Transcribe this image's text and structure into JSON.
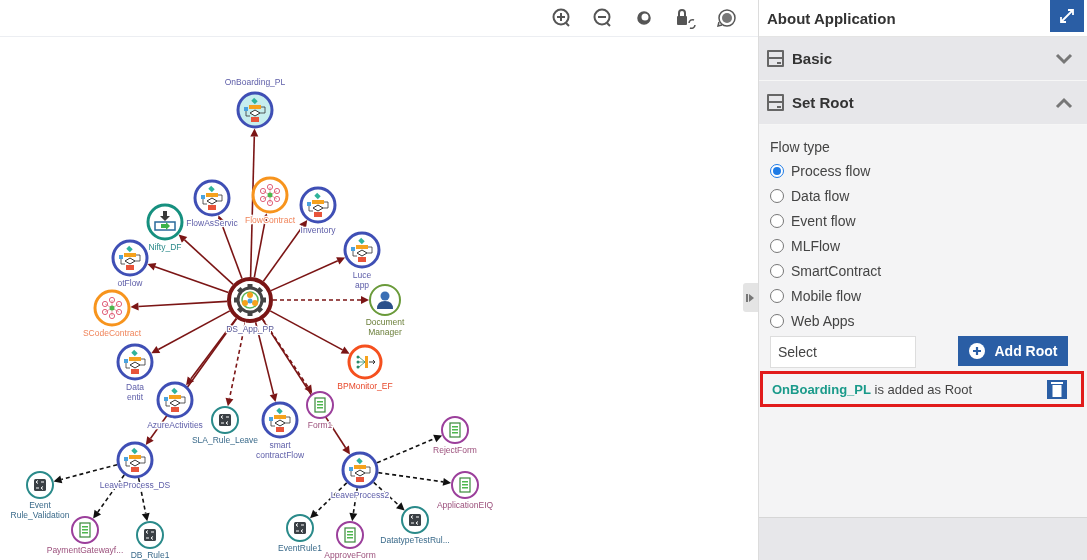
{
  "toolbar": {
    "tools": [
      {
        "kind": "zoom-in"
      },
      {
        "kind": "zoom-out"
      },
      {
        "kind": "reset"
      },
      {
        "kind": "lock"
      },
      {
        "kind": "rotate"
      }
    ]
  },
  "graph": {
    "root": {
      "kind": "root",
      "lines": [
        "DS_App_PP"
      ],
      "highlighted": false,
      "children": [
        {
          "kind": "process",
          "lines": [
            "OnBoarding_PL"
          ],
          "highlighted": true,
          "dashed": false
        },
        {
          "kind": "dataflow",
          "lines": [
            "Nifty_DF"
          ],
          "highlighted": false,
          "dashed": false
        },
        {
          "kind": "process",
          "lines": [
            "FlowAsServic"
          ],
          "highlighted": false,
          "dashed": false
        },
        {
          "kind": "contract",
          "lines": [
            "FlowContract"
          ],
          "highlighted": false,
          "dashed": false
        },
        {
          "kind": "process",
          "lines": [
            "Inventory"
          ],
          "highlighted": false,
          "dashed": false
        },
        {
          "kind": "process",
          "lines": [
            "otFlow"
          ],
          "highlighted": false,
          "dashed": false
        },
        {
          "kind": "process",
          "lines": [
            "Luce",
            "app"
          ],
          "highlighted": false,
          "dashed": false
        },
        {
          "kind": "contract",
          "lines": [
            "SCodeContract"
          ],
          "highlighted": false,
          "dashed": false
        },
        {
          "kind": "user",
          "lines": [
            "Document",
            "Manager"
          ],
          "highlighted": false,
          "dashed": true
        },
        {
          "kind": "process",
          "lines": [
            "Data",
            "entit"
          ],
          "highlighted": false,
          "dashed": false
        },
        {
          "kind": "monitor",
          "lines": [
            "BPMonitor_EF"
          ],
          "highlighted": false,
          "dashed": false
        },
        {
          "kind": "process",
          "lines": [
            "AzureActivities"
          ],
          "highlighted": false,
          "dashed": false
        },
        {
          "kind": "form",
          "lines": [
            "Form1"
          ],
          "highlighted": false,
          "dashed": true
        },
        {
          "kind": "rule",
          "lines": [
            "SLA_Rule_Leave"
          ],
          "highlighted": false,
          "dashed": true
        },
        {
          "kind": "process",
          "lines": [
            "smart",
            "contractFlow"
          ],
          "highlighted": false,
          "dashed": false
        },
        {
          "kind": "process",
          "lines": [
            "LeaveProcess_DS"
          ],
          "highlighted": false,
          "dashed": false,
          "children": [
            {
              "kind": "rule",
              "lines": [
                "Event",
                "Rule_Validation"
              ],
              "highlighted": false,
              "dashed": true
            },
            {
              "kind": "form",
              "lines": [
                "PaymentGatewayf..."
              ],
              "highlighted": false,
              "dashed": true
            },
            {
              "kind": "rule",
              "lines": [
                "DB_Rule1"
              ],
              "highlighted": false,
              "dashed": true
            }
          ]
        },
        {
          "kind": "process",
          "lines": [
            "LeaveProcess2"
          ],
          "highlighted": false,
          "dashed": false,
          "children": [
            {
              "kind": "form",
              "lines": [
                "RejectForm"
              ],
              "highlighted": false,
              "dashed": true
            },
            {
              "kind": "form",
              "lines": [
                "ApplicationEIQ"
              ],
              "highlighted": false,
              "dashed": true
            },
            {
              "kind": "rule",
              "lines": [
                "EventRule1"
              ],
              "highlighted": false,
              "dashed": true
            },
            {
              "kind": "form",
              "lines": [
                "ApproveForm"
              ],
              "highlighted": false,
              "dashed": true
            },
            {
              "kind": "rule",
              "lines": [
                "DatatypeTestRul..."
              ],
              "highlighted": false,
              "dashed": true
            }
          ]
        }
      ]
    }
  },
  "panel": {
    "title": "About Application",
    "sections": [
      {
        "label": "Basic",
        "expanded": false
      },
      {
        "label": "Set Root",
        "expanded": true
      }
    ],
    "flow_type_label": "Flow type",
    "flow_types": [
      {
        "label": "Process flow",
        "selected": true
      },
      {
        "label": "Data flow",
        "selected": false
      },
      {
        "label": "Event flow",
        "selected": false
      },
      {
        "label": "MLFlow",
        "selected": false
      },
      {
        "label": "SmartContract",
        "selected": false
      },
      {
        "label": "Mobile flow",
        "selected": false
      },
      {
        "label": "Web Apps",
        "selected": false
      }
    ],
    "select": {
      "placeholder": "Select"
    },
    "add_button": "Add Root",
    "root_message": {
      "text": "**OnBoarding_PL** is added as Root",
      "highlighted": true
    }
  }
}
